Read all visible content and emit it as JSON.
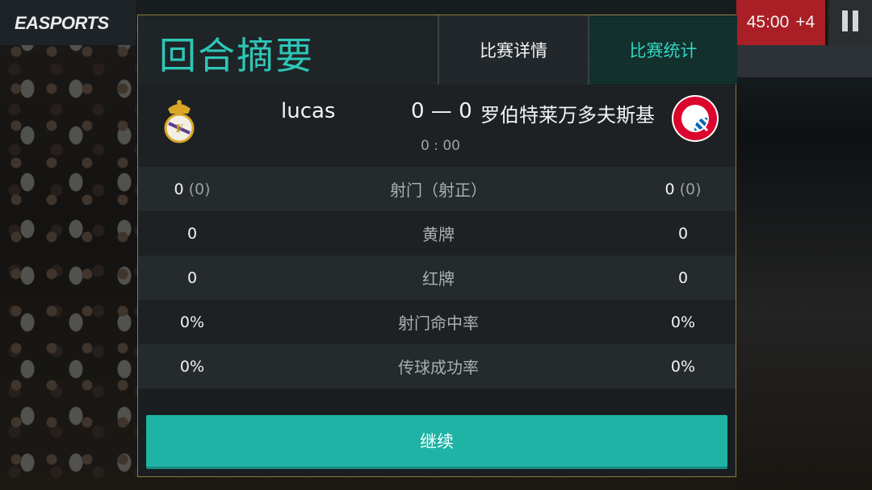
{
  "hud": {
    "brand": "EASPORTS",
    "clock": "45:00",
    "added_time": "+4"
  },
  "dialog": {
    "title": "回合摘要",
    "tabs": [
      {
        "label": "比赛详情",
        "active": false
      },
      {
        "label": "比赛统计",
        "active": true
      }
    ]
  },
  "match": {
    "home_team": "lucas",
    "away_team": "罗伯特莱万多夫斯基",
    "score": "0 — 0",
    "time": "0 : 00"
  },
  "stats": [
    {
      "label": "射门（射正）",
      "home": "0",
      "home_extra": "(0)",
      "away": "0",
      "away_extra": "(0)"
    },
    {
      "label": "黄牌",
      "home": "0",
      "home_extra": "",
      "away": "0",
      "away_extra": ""
    },
    {
      "label": "红牌",
      "home": "0",
      "home_extra": "",
      "away": "0",
      "away_extra": ""
    },
    {
      "label": "射门命中率",
      "home": "0%",
      "home_extra": "",
      "away": "0%",
      "away_extra": ""
    },
    {
      "label": "传球成功率",
      "home": "0%",
      "home_extra": "",
      "away": "0%",
      "away_extra": ""
    }
  ],
  "continue_label": "继续",
  "colors": {
    "accent": "#2ec6b6",
    "button": "#1fb3a5",
    "clock_bg": "#a91f25"
  }
}
